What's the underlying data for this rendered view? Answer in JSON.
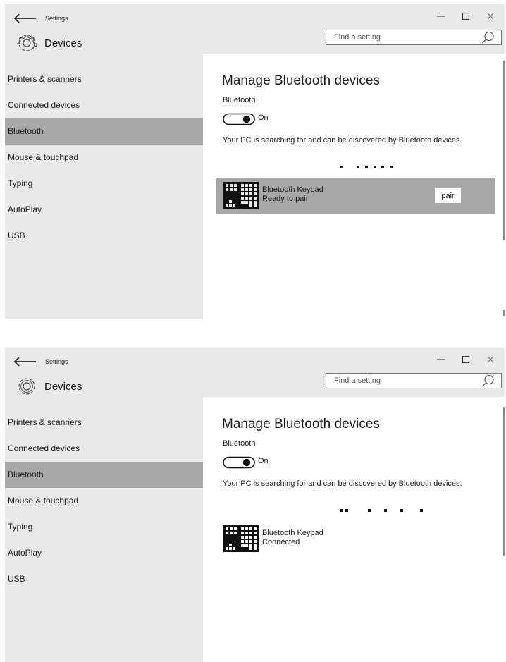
{
  "window": {
    "title": "Settings",
    "section_title": "Devices",
    "search_placeholder": "Find a setting",
    "controls": [
      "minimize",
      "maximize",
      "close"
    ]
  },
  "sidebar": {
    "items": [
      {
        "label": "Printers & scanners"
      },
      {
        "label": "Connected devices"
      },
      {
        "label": "Bluetooth",
        "selected": true
      },
      {
        "label": "Mouse & touchpad"
      },
      {
        "label": "Typing"
      },
      {
        "label": "AutoPlay"
      },
      {
        "label": "USB"
      }
    ]
  },
  "bluetooth": {
    "heading": "Manage Bluetooth devices",
    "subheading": "Bluetooth",
    "toggle_label": "On",
    "toggle_on": true,
    "description": "Your PC is searching for and can be discovered by Bluetooth devices."
  },
  "screens": [
    {
      "device": {
        "name": "Bluetooth Keypad",
        "status": "Ready to pair",
        "action_label": "pair",
        "highlighted": true
      }
    },
    {
      "device": {
        "name": "Bluetooth Keypad",
        "status": "Connected",
        "highlighted": false
      }
    }
  ],
  "icons": {
    "back": "back-arrow-icon",
    "gear": "gear-icon",
    "search": "search-icon",
    "minimize": "minimize-icon",
    "maximize": "maximize-icon",
    "close": "close-icon",
    "device": "keypad-icon"
  },
  "colors": {
    "chrome": "#e9e9e9",
    "selected": "#a8a8a8",
    "highlight": "#a7a7a7",
    "text": "#1a1a1a"
  }
}
